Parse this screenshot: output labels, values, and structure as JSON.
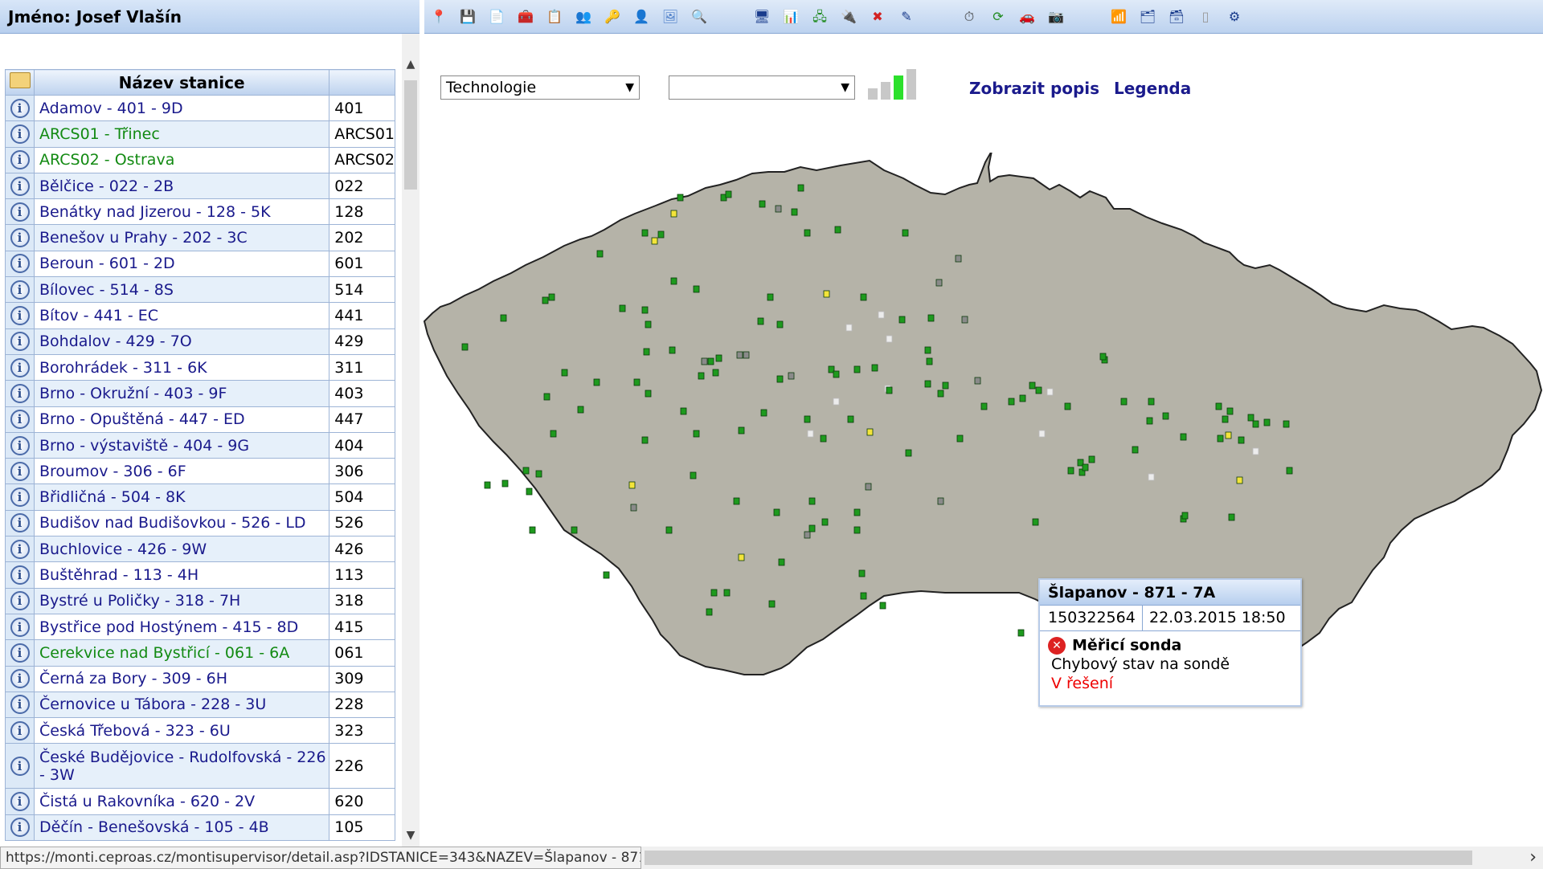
{
  "user": {
    "name_label": "Jméno: Josef Vlašín"
  },
  "toolbar": {
    "icons": [
      {
        "name": "map-pin-icon",
        "glyph": "📍",
        "color": "#2d6b2d"
      },
      {
        "name": "save-icon",
        "glyph": "💾",
        "color": "#1a3c8c"
      },
      {
        "name": "document-export-icon",
        "glyph": "📄",
        "color": "#1f8a1f"
      },
      {
        "name": "tools-icon",
        "glyph": "🧰",
        "color": "#555"
      },
      {
        "name": "report-icon",
        "glyph": "📋",
        "color": "#8c5a1a"
      },
      {
        "name": "users-icon",
        "glyph": "👥",
        "color": "#4a4a4a"
      },
      {
        "name": "key-icon",
        "glyph": "🔑",
        "color": "#c8a000"
      },
      {
        "name": "person-icon",
        "glyph": "👤",
        "color": "#c8a000"
      },
      {
        "name": "image-icon",
        "glyph": "🖼",
        "color": "#4a7cc8"
      },
      {
        "name": "search-icon",
        "glyph": "🔍",
        "color": "#1a3c8c"
      },
      {
        "name": "monitor-icon",
        "glyph": "🖥",
        "color": "#1a3c8c"
      },
      {
        "name": "chart-icon",
        "glyph": "📊",
        "color": "#c83a1a"
      },
      {
        "name": "network-icon",
        "glyph": "🖧",
        "color": "#1f8a1f"
      },
      {
        "name": "plug-icon",
        "glyph": "🔌",
        "color": "#1a3c8c"
      },
      {
        "name": "stop-icon",
        "glyph": "✖",
        "color": "#d22222"
      },
      {
        "name": "edit-check-icon",
        "glyph": "✎",
        "color": "#1a3c8c"
      },
      {
        "name": "clock-icon",
        "glyph": "⏱",
        "color": "#333"
      },
      {
        "name": "refresh-icon",
        "glyph": "⟳",
        "color": "#1f8a1f"
      },
      {
        "name": "car-icon",
        "glyph": "🚗",
        "color": "#c83a1a"
      },
      {
        "name": "camera-icon",
        "glyph": "📷",
        "color": "#333"
      },
      {
        "name": "signal-icon",
        "glyph": "📶",
        "color": "#1f8a1f"
      },
      {
        "name": "gallery-icon",
        "glyph": "🗂",
        "color": "#1a3c8c"
      },
      {
        "name": "gallery-check-icon",
        "glyph": "🗃",
        "color": "#1a3c8c"
      },
      {
        "name": "blank-page-icon",
        "glyph": "▯",
        "color": "#999"
      },
      {
        "name": "settings-window-icon",
        "glyph": "⚙",
        "color": "#1a3c8c"
      }
    ]
  },
  "station_list": {
    "header": "Název stanice",
    "rows": [
      {
        "name": "Adamov - 401 - 9D",
        "code": "401",
        "green": false
      },
      {
        "name": "ARCS01 - Třinec",
        "code": "ARCS01",
        "green": true
      },
      {
        "name": "ARCS02 - Ostrava",
        "code": "ARCS02",
        "green": true
      },
      {
        "name": "Bělčice - 022 - 2B",
        "code": "022",
        "green": false
      },
      {
        "name": "Benátky nad Jizerou - 128 - 5K",
        "code": "128",
        "green": false
      },
      {
        "name": "Benešov u Prahy - 202 - 3C",
        "code": "202",
        "green": false
      },
      {
        "name": "Beroun - 601 - 2D",
        "code": "601",
        "green": false
      },
      {
        "name": "Bílovec - 514 - 8S",
        "code": "514",
        "green": false
      },
      {
        "name": "Bítov - 441 - EC",
        "code": "441",
        "green": false
      },
      {
        "name": "Bohdalov - 429 - 7O",
        "code": "429",
        "green": false
      },
      {
        "name": "Borohrádek - 311 - 6K",
        "code": "311",
        "green": false
      },
      {
        "name": "Brno - Okružní - 403 - 9F",
        "code": "403",
        "green": false
      },
      {
        "name": "Brno - Opuštěná - 447 - ED",
        "code": "447",
        "green": false
      },
      {
        "name": "Brno - výstaviště - 404 - 9G",
        "code": "404",
        "green": false
      },
      {
        "name": "Broumov - 306 - 6F",
        "code": "306",
        "green": false
      },
      {
        "name": "Břidličná - 504 - 8K",
        "code": "504",
        "green": false
      },
      {
        "name": "Budišov nad Budišovkou - 526 - LD",
        "code": "526",
        "green": false
      },
      {
        "name": "Buchlovice - 426 - 9W",
        "code": "426",
        "green": false
      },
      {
        "name": "Buštěhrad - 113 - 4H",
        "code": "113",
        "green": false
      },
      {
        "name": "Bystré u Poličky - 318 - 7H",
        "code": "318",
        "green": false
      },
      {
        "name": "Bystřice pod Hostýnem - 415 - 8D",
        "code": "415",
        "green": false
      },
      {
        "name": "Cerekvice nad Bystřicí - 061 - 6A",
        "code": "061",
        "green": true
      },
      {
        "name": "Černá za Bory - 309 - 6H",
        "code": "309",
        "green": false
      },
      {
        "name": "Černovice u Tábora - 228 - 3U",
        "code": "228",
        "green": false
      },
      {
        "name": "Česká Třebová - 323 - 6U",
        "code": "323",
        "green": false
      },
      {
        "name": "České Budějovice - Rudolfovská - 226 - 3W",
        "code": "226",
        "green": false,
        "tall": true
      },
      {
        "name": "Čistá u Rakovníka - 620 - 2V",
        "code": "620",
        "green": false
      },
      {
        "name": "Děčín - Benešovská - 105 - 4B",
        "code": "105",
        "green": false
      }
    ]
  },
  "controls": {
    "select1_value": "Technologie",
    "select2_value": "",
    "show_description_label": "Zobrazit popis",
    "legend_label": "Legenda"
  },
  "map": {
    "fill_color": "#b5b3a8",
    "stroke_color": "#222222"
  },
  "popup": {
    "title": "Šlapanov - 871 - 7A",
    "id": "150322564",
    "datetime": "22.03.2015 18:50",
    "device": "Měřicí sonda",
    "description": "Chybový stav na sondě",
    "state": "V řešení"
  },
  "status_bar": {
    "url": "https://monti.ceproas.cz/montisupervisor/detail.asp?IDSTANICE=343&NAZEV=Šlapanov - 871 - 7A"
  }
}
